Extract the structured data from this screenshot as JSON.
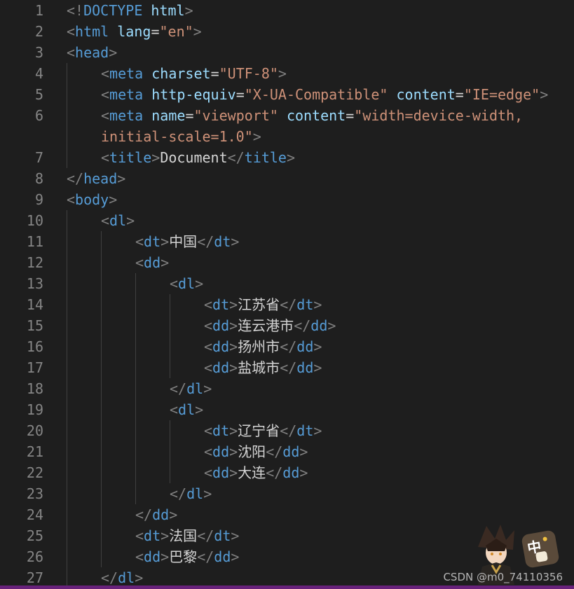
{
  "lines": [
    {
      "n": "1",
      "indent": 0,
      "t": [
        [
          "br",
          "<!"
        ],
        [
          "tag",
          "DOCTYPE "
        ],
        [
          "attr",
          "html"
        ],
        [
          "br",
          ">"
        ]
      ]
    },
    {
      "n": "2",
      "indent": 0,
      "t": [
        [
          "br",
          "<"
        ],
        [
          "tag",
          "html "
        ],
        [
          "attr",
          "lang"
        ],
        [
          "eq",
          "="
        ],
        [
          "str",
          "\"en\""
        ],
        [
          "br",
          ">"
        ]
      ]
    },
    {
      "n": "3",
      "indent": 0,
      "t": [
        [
          "br",
          "<"
        ],
        [
          "tag",
          "head"
        ],
        [
          "br",
          ">"
        ]
      ]
    },
    {
      "n": "4",
      "indent": 1,
      "t": [
        [
          "br",
          "<"
        ],
        [
          "tag",
          "meta "
        ],
        [
          "attr",
          "charset"
        ],
        [
          "eq",
          "="
        ],
        [
          "str",
          "\"UTF-8\""
        ],
        [
          "br",
          ">"
        ]
      ]
    },
    {
      "n": "5",
      "indent": 1,
      "t": [
        [
          "br",
          "<"
        ],
        [
          "tag",
          "meta "
        ],
        [
          "attr",
          "http-equiv"
        ],
        [
          "eq",
          "="
        ],
        [
          "str",
          "\"X-UA-Compatible\" "
        ],
        [
          "attr",
          "content"
        ],
        [
          "eq",
          "="
        ],
        [
          "str",
          "\"IE=edge\""
        ],
        [
          "br",
          ">"
        ]
      ]
    },
    {
      "n": "6",
      "indent": 1,
      "t": [
        [
          "br",
          "<"
        ],
        [
          "tag",
          "meta "
        ],
        [
          "attr",
          "name"
        ],
        [
          "eq",
          "="
        ],
        [
          "str",
          "\"viewport\" "
        ],
        [
          "attr",
          "content"
        ],
        [
          "eq",
          "="
        ],
        [
          "str",
          "\"width=device-width,"
        ]
      ]
    },
    {
      "n": "",
      "indent": 1,
      "t": [
        [
          "str",
          "initial-scale=1.0\""
        ],
        [
          "br",
          ">"
        ]
      ]
    },
    {
      "n": "7",
      "indent": 1,
      "t": [
        [
          "br",
          "<"
        ],
        [
          "tag",
          "title"
        ],
        [
          "br",
          ">"
        ],
        [
          "txt",
          "Document"
        ],
        [
          "br",
          "</"
        ],
        [
          "tag",
          "title"
        ],
        [
          "br",
          ">"
        ]
      ]
    },
    {
      "n": "8",
      "indent": 0,
      "t": [
        [
          "br",
          "</"
        ],
        [
          "tag",
          "head"
        ],
        [
          "br",
          ">"
        ]
      ]
    },
    {
      "n": "9",
      "indent": 0,
      "t": [
        [
          "br",
          "<"
        ],
        [
          "tag",
          "body"
        ],
        [
          "br",
          ">"
        ]
      ]
    },
    {
      "n": "10",
      "indent": 1,
      "t": [
        [
          "br",
          "<"
        ],
        [
          "tag",
          "dl"
        ],
        [
          "br",
          ">"
        ]
      ]
    },
    {
      "n": "11",
      "indent": 2,
      "t": [
        [
          "br",
          "<"
        ],
        [
          "tag",
          "dt"
        ],
        [
          "br",
          ">"
        ],
        [
          "txt",
          "中国"
        ],
        [
          "br",
          "</"
        ],
        [
          "tag",
          "dt"
        ],
        [
          "br",
          ">"
        ]
      ]
    },
    {
      "n": "12",
      "indent": 2,
      "t": [
        [
          "br",
          "<"
        ],
        [
          "tag",
          "dd"
        ],
        [
          "br",
          ">"
        ]
      ]
    },
    {
      "n": "13",
      "indent": 3,
      "t": [
        [
          "br",
          "<"
        ],
        [
          "tag",
          "dl"
        ],
        [
          "br",
          ">"
        ]
      ]
    },
    {
      "n": "14",
      "indent": 4,
      "t": [
        [
          "br",
          "<"
        ],
        [
          "tag",
          "dt"
        ],
        [
          "br",
          ">"
        ],
        [
          "txt",
          "江苏省"
        ],
        [
          "br",
          "</"
        ],
        [
          "tag",
          "dt"
        ],
        [
          "br",
          ">"
        ]
      ]
    },
    {
      "n": "15",
      "indent": 4,
      "t": [
        [
          "br",
          "<"
        ],
        [
          "tag",
          "dd"
        ],
        [
          "br",
          ">"
        ],
        [
          "txt",
          "连云港市"
        ],
        [
          "br",
          "</"
        ],
        [
          "tag",
          "dd"
        ],
        [
          "br",
          ">"
        ]
      ]
    },
    {
      "n": "16",
      "indent": 4,
      "t": [
        [
          "br",
          "<"
        ],
        [
          "tag",
          "dd"
        ],
        [
          "br",
          ">"
        ],
        [
          "txt",
          "扬州市"
        ],
        [
          "br",
          "</"
        ],
        [
          "tag",
          "dd"
        ],
        [
          "br",
          ">"
        ]
      ]
    },
    {
      "n": "17",
      "indent": 4,
      "t": [
        [
          "br",
          "<"
        ],
        [
          "tag",
          "dd"
        ],
        [
          "br",
          ">"
        ],
        [
          "txt",
          "盐城市"
        ],
        [
          "br",
          "</"
        ],
        [
          "tag",
          "dd"
        ],
        [
          "br",
          ">"
        ]
      ]
    },
    {
      "n": "18",
      "indent": 3,
      "t": [
        [
          "br",
          "</"
        ],
        [
          "tag",
          "dl"
        ],
        [
          "br",
          ">"
        ]
      ]
    },
    {
      "n": "19",
      "indent": 3,
      "t": [
        [
          "br",
          "<"
        ],
        [
          "tag",
          "dl"
        ],
        [
          "br",
          ">"
        ]
      ]
    },
    {
      "n": "20",
      "indent": 4,
      "t": [
        [
          "br",
          "<"
        ],
        [
          "tag",
          "dt"
        ],
        [
          "br",
          ">"
        ],
        [
          "txt",
          "辽宁省"
        ],
        [
          "br",
          "</"
        ],
        [
          "tag",
          "dt"
        ],
        [
          "br",
          ">"
        ]
      ]
    },
    {
      "n": "21",
      "indent": 4,
      "t": [
        [
          "br",
          "<"
        ],
        [
          "tag",
          "dd"
        ],
        [
          "br",
          ">"
        ],
        [
          "txt",
          "沈阳"
        ],
        [
          "br",
          "</"
        ],
        [
          "tag",
          "dd"
        ],
        [
          "br",
          ">"
        ]
      ]
    },
    {
      "n": "22",
      "indent": 4,
      "t": [
        [
          "br",
          "<"
        ],
        [
          "tag",
          "dd"
        ],
        [
          "br",
          ">"
        ],
        [
          "txt",
          "大连"
        ],
        [
          "br",
          "</"
        ],
        [
          "tag",
          "dd"
        ],
        [
          "br",
          ">"
        ]
      ]
    },
    {
      "n": "23",
      "indent": 3,
      "t": [
        [
          "br",
          "</"
        ],
        [
          "tag",
          "dl"
        ],
        [
          "br",
          ">"
        ]
      ]
    },
    {
      "n": "24",
      "indent": 2,
      "t": [
        [
          "br",
          "</"
        ],
        [
          "tag",
          "dd"
        ],
        [
          "br",
          ">"
        ]
      ]
    },
    {
      "n": "25",
      "indent": 2,
      "t": [
        [
          "br",
          "<"
        ],
        [
          "tag",
          "dt"
        ],
        [
          "br",
          ">"
        ],
        [
          "txt",
          "法国"
        ],
        [
          "br",
          "</"
        ],
        [
          "tag",
          "dt"
        ],
        [
          "br",
          ">"
        ]
      ]
    },
    {
      "n": "26",
      "indent": 2,
      "t": [
        [
          "br",
          "<"
        ],
        [
          "tag",
          "dd"
        ],
        [
          "br",
          ">"
        ],
        [
          "txt",
          "巴黎"
        ],
        [
          "br",
          "</"
        ],
        [
          "tag",
          "dd"
        ],
        [
          "br",
          ">"
        ]
      ]
    },
    {
      "n": "27",
      "indent": 1,
      "t": [
        [
          "br",
          "</"
        ],
        [
          "tag",
          "dl"
        ],
        [
          "br",
          ">"
        ]
      ]
    }
  ],
  "watermark": "CSDN @m0_74110356",
  "colors": {
    "background": "#1e1e1e",
    "tag": "#569cd6",
    "bracket": "#808080",
    "attribute": "#9cdcfe",
    "string": "#ce9178",
    "text": "#d4d4d4",
    "line_number": "#858585",
    "accent_bar": "#68217a"
  },
  "stickers": {
    "character_icon": "anime-character-sticker",
    "badge_icon": "zhong-badge-icon",
    "badge_text": "中"
  }
}
